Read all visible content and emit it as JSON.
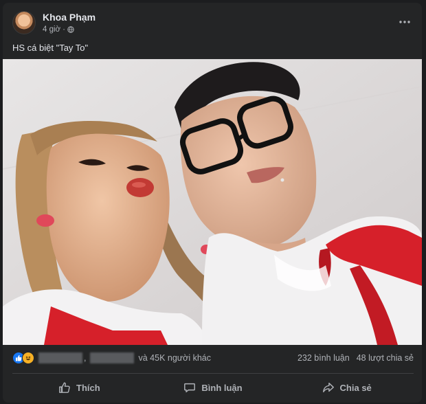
{
  "post": {
    "author": "Khoa Phạm",
    "time": "4 giờ",
    "separator": "·",
    "more_icon": "ellipsis-icon",
    "privacy_icon": "globe-icon",
    "caption": "HS cá biệt \"Tay To\""
  },
  "stats": {
    "reaction_icons": [
      "like-icon",
      "haha-icon"
    ],
    "comma": ",",
    "others": "và 45K người khác",
    "comments": "232 bình luận",
    "shares": "48 lượt chia sẻ"
  },
  "actions": {
    "like": "Thích",
    "comment": "Bình luận",
    "share": "Chia sẻ"
  },
  "colors": {
    "card_bg": "#242526",
    "page_bg": "#1c1d1f",
    "text_primary": "#e4e6eb",
    "text_secondary": "#b0b3b8",
    "like_blue": "#1877f2",
    "haha_yellow": "#f7b125",
    "scarf_red": "#d6202a"
  }
}
